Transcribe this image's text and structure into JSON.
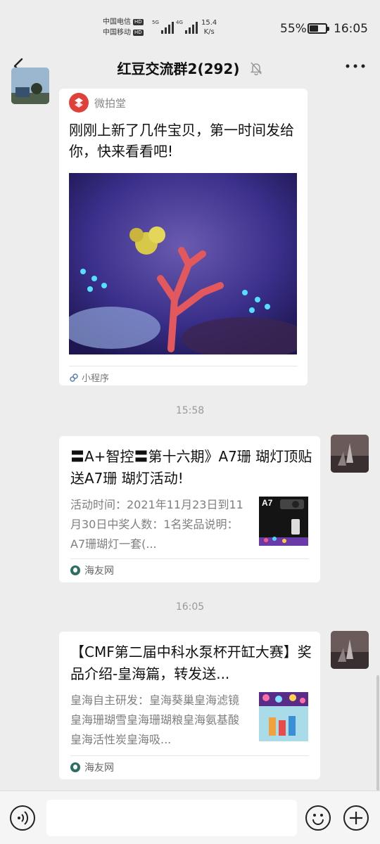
{
  "status_bar": {
    "carrier1": "中国电信",
    "carrier2": "中国移动",
    "hd": "HD",
    "net1": "5G",
    "net2": "4G",
    "speed_value": "15.4",
    "speed_unit": "K/s",
    "battery_percent": "55%",
    "battery_level": 0.55,
    "time": "16:05"
  },
  "header": {
    "title": "红豆交流群2(292)",
    "back_icon": "chevron-left-icon",
    "mute_icon": "bell-off-icon",
    "more_icon": "more-dots-icon"
  },
  "messages": {
    "mini_program": {
      "source": "微拍堂",
      "text": "刚刚上新了几件宝贝，第一时间发给你，快来看看吧!",
      "footer": "小程序"
    },
    "time1": "15:58",
    "link1": {
      "title": "〓A+智控〓第十六期》A7珊 瑚灯顶贴送A7珊 瑚灯活动!",
      "desc": "活动时间：2021年11月23日到11月30日中奖人数：1名奖品说明：A7珊瑚灯一套(...",
      "thumb_label": "A7",
      "source": "海友网"
    },
    "time2": "16:05",
    "link2": {
      "title": "【CMF第二届中科水泵杯开缸大赛】奖品介绍-皇海篇，转发送...",
      "desc": "皇海自主研发：皇海葵巢皇海滤镜皇海珊瑚雪皇海珊瑚粮皇海氨基酸皇海活性炭皇海吸...",
      "source": "海友网"
    }
  },
  "input_bar": {
    "voice_icon": "voice-icon",
    "emoji_icon": "emoji-icon",
    "plus_icon": "plus-icon",
    "placeholder": ""
  },
  "colors": {
    "background": "#ededed",
    "bubble": "#ffffff",
    "weipaitang_red": "#e0403a",
    "source_icon": "#2c6e63"
  }
}
